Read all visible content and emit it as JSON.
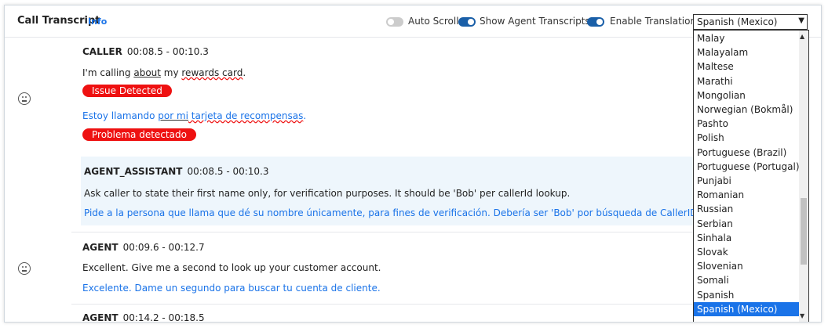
{
  "header": {
    "title": "Call Transcript",
    "info": "Info",
    "auto_scroll_label": "Auto Scroll",
    "show_agent_label": "Show Agent Transcripts?",
    "enable_translation_label": "Enable Translation",
    "language_select_value": "Spanish (Mexico)"
  },
  "dropdown": {
    "options": [
      "Malay",
      "Malayalam",
      "Maltese",
      "Marathi",
      "Mongolian",
      "Norwegian (Bokmål)",
      "Pashto",
      "Polish",
      "Portuguese (Brazil)",
      "Portuguese (Portugal)",
      "Punjabi",
      "Romanian",
      "Russian",
      "Serbian",
      "Sinhala",
      "Slovak",
      "Slovenian",
      "Somali",
      "Spanish",
      "Spanish (Mexico)"
    ],
    "selected": "Spanish (Mexico)"
  },
  "transcript": [
    {
      "speaker": "CALLER",
      "time": "00:08.5 - 00:10.3",
      "text_a": "I'm calling ",
      "text_b": "about",
      "text_c": " my ",
      "text_d": "rewards card",
      "text_e": ".",
      "badge": "Issue Detected",
      "trans_a": "Estoy llamando ",
      "trans_b": "por mi",
      "trans_c": " tarjeta de recompensas",
      "trans_d": ".",
      "trans_badge": "Problema detectado"
    },
    {
      "speaker": "AGENT_ASSISTANT",
      "time": "00:08.5 - 00:10.3",
      "text": "Ask caller to state their first name only, for verification purposes. It should be 'Bob' per callerId lookup.",
      "translation": "Pide a la persona que llama que dé su nombre únicamente, para fines de verificación. Debería ser 'Bob' por búsqueda de CallerID."
    },
    {
      "speaker": "AGENT",
      "time": "00:09.6 - 00:12.7",
      "text": "Excellent. Give me a second to look up your customer account.",
      "translation": "Excelente. Dame un segundo para buscar tu cuenta de cliente."
    },
    {
      "speaker": "AGENT",
      "time": "00:14.2 - 00:18.5"
    }
  ],
  "colors": {
    "accent": "#1a73e8",
    "badge": "#ee1111",
    "toggle_on": "#1a5fa8"
  }
}
